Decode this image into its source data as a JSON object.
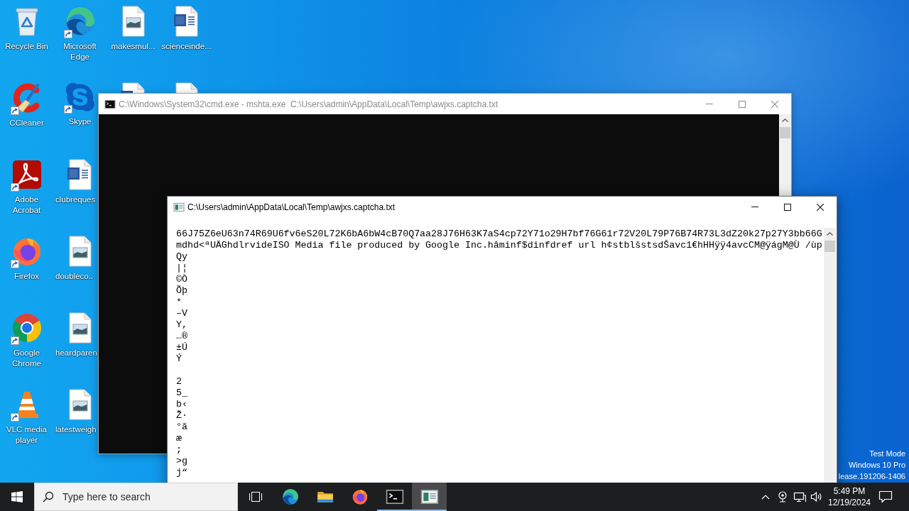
{
  "desktop": {
    "icon_columns": [
      [
        {
          "kind": "recycle-bin",
          "label": "Recycle Bin",
          "shortcut": false,
          "covered": false,
          "cut_off": false
        },
        {
          "kind": "ccleaner",
          "label": "CCleaner",
          "shortcut": true,
          "covered": false,
          "cut_off": false
        },
        {
          "kind": "acrobat",
          "label": "Adobe Acrobat",
          "shortcut": true,
          "covered": false,
          "cut_off": false
        },
        {
          "kind": "firefox",
          "label": "Firefox",
          "shortcut": true,
          "covered": false,
          "cut_off": false
        },
        {
          "kind": "chrome",
          "label": "Google Chrome",
          "shortcut": true,
          "covered": false,
          "cut_off": false
        },
        {
          "kind": "vlc",
          "label": "VLC media player",
          "shortcut": true,
          "covered": false,
          "cut_off": false
        }
      ],
      [
        {
          "kind": "edge",
          "label": "Microsoft Edge",
          "shortcut": true,
          "covered": false,
          "cut_off": false
        },
        {
          "kind": "skype",
          "label": "Skype",
          "shortcut": true,
          "covered": false,
          "cut_off": false
        },
        {
          "kind": "word-file",
          "label": "clubreques",
          "shortcut": false,
          "covered": false,
          "cut_off": true
        },
        {
          "kind": "image-file",
          "label": "doubleco..",
          "shortcut": false,
          "covered": false,
          "cut_off": true
        },
        {
          "kind": "image-file",
          "label": "heardparen",
          "shortcut": false,
          "covered": false,
          "cut_off": true
        },
        {
          "kind": "image-file",
          "label": "latestweigh",
          "shortcut": false,
          "covered": false,
          "cut_off": true
        }
      ],
      [
        {
          "kind": "image-file",
          "label": "makesmul...",
          "shortcut": false,
          "covered": false,
          "cut_off": false
        },
        {
          "kind": "word-file",
          "covered": true
        }
      ],
      [
        {
          "kind": "word-file",
          "label": "scienceinde...",
          "shortcut": false,
          "covered": false,
          "cut_off": false
        },
        {
          "kind": "file",
          "covered": true
        }
      ]
    ],
    "system_notice": [
      "Test Mode",
      "Windows 10 Pro",
      "lease.191206-1406"
    ]
  },
  "windows": [
    {
      "kind": "console",
      "title": "C:\\Windows\\System32\\cmd.exe - mshta.exe  C:\\Users\\admin\\AppData\\Local\\Temp\\awjxs.captcha.txt",
      "active": false
    },
    {
      "kind": "text-viewer",
      "title": "C:\\Users\\admin\\AppData\\Local\\Temp\\awjxs.captcha.txt",
      "active": true,
      "text_blocks": [
        [
          "66J75Z6eU63n74R69U6fv6eS20L72K6bA6bW4cB70Q7aa28J76H63K7aS4cp72Y71o29H7bf76G61r72V20L79P76B74R73L3dZ20k27p27Y3bb66G",
          "mdhd<ªUÄGhdlrvideISO Media file produced by Google Inc.hâminf$dinfdref url h¢stblšstsdŠavc1€hHHÿÿ4avcCM@ÿágM@Ù /ùp",
          "Qy",
          "|¦",
          "©Ò",
          "Õþ",
          "*",
          "–V",
          "Y,",
          "…®",
          "±Ú",
          "Ý"
        ],
        [
          "2",
          "5_",
          "b‹",
          "Ž·",
          "°ã",
          "æ",
          ";",
          ">g",
          "j“"
        ]
      ]
    }
  ],
  "taskbar": {
    "search": {
      "placeholder": "Type here to search"
    },
    "apps": [
      {
        "kind": "edge",
        "running": false,
        "selected": false
      },
      {
        "kind": "file-explorer",
        "running": false,
        "selected": false
      },
      {
        "kind": "firefox",
        "running": false,
        "selected": false
      },
      {
        "kind": "console",
        "running": true,
        "selected": false
      },
      {
        "kind": "text-viewer",
        "running": true,
        "selected": true
      }
    ],
    "clock": {
      "time": "5:49 PM",
      "date": "12/19/2024"
    }
  }
}
